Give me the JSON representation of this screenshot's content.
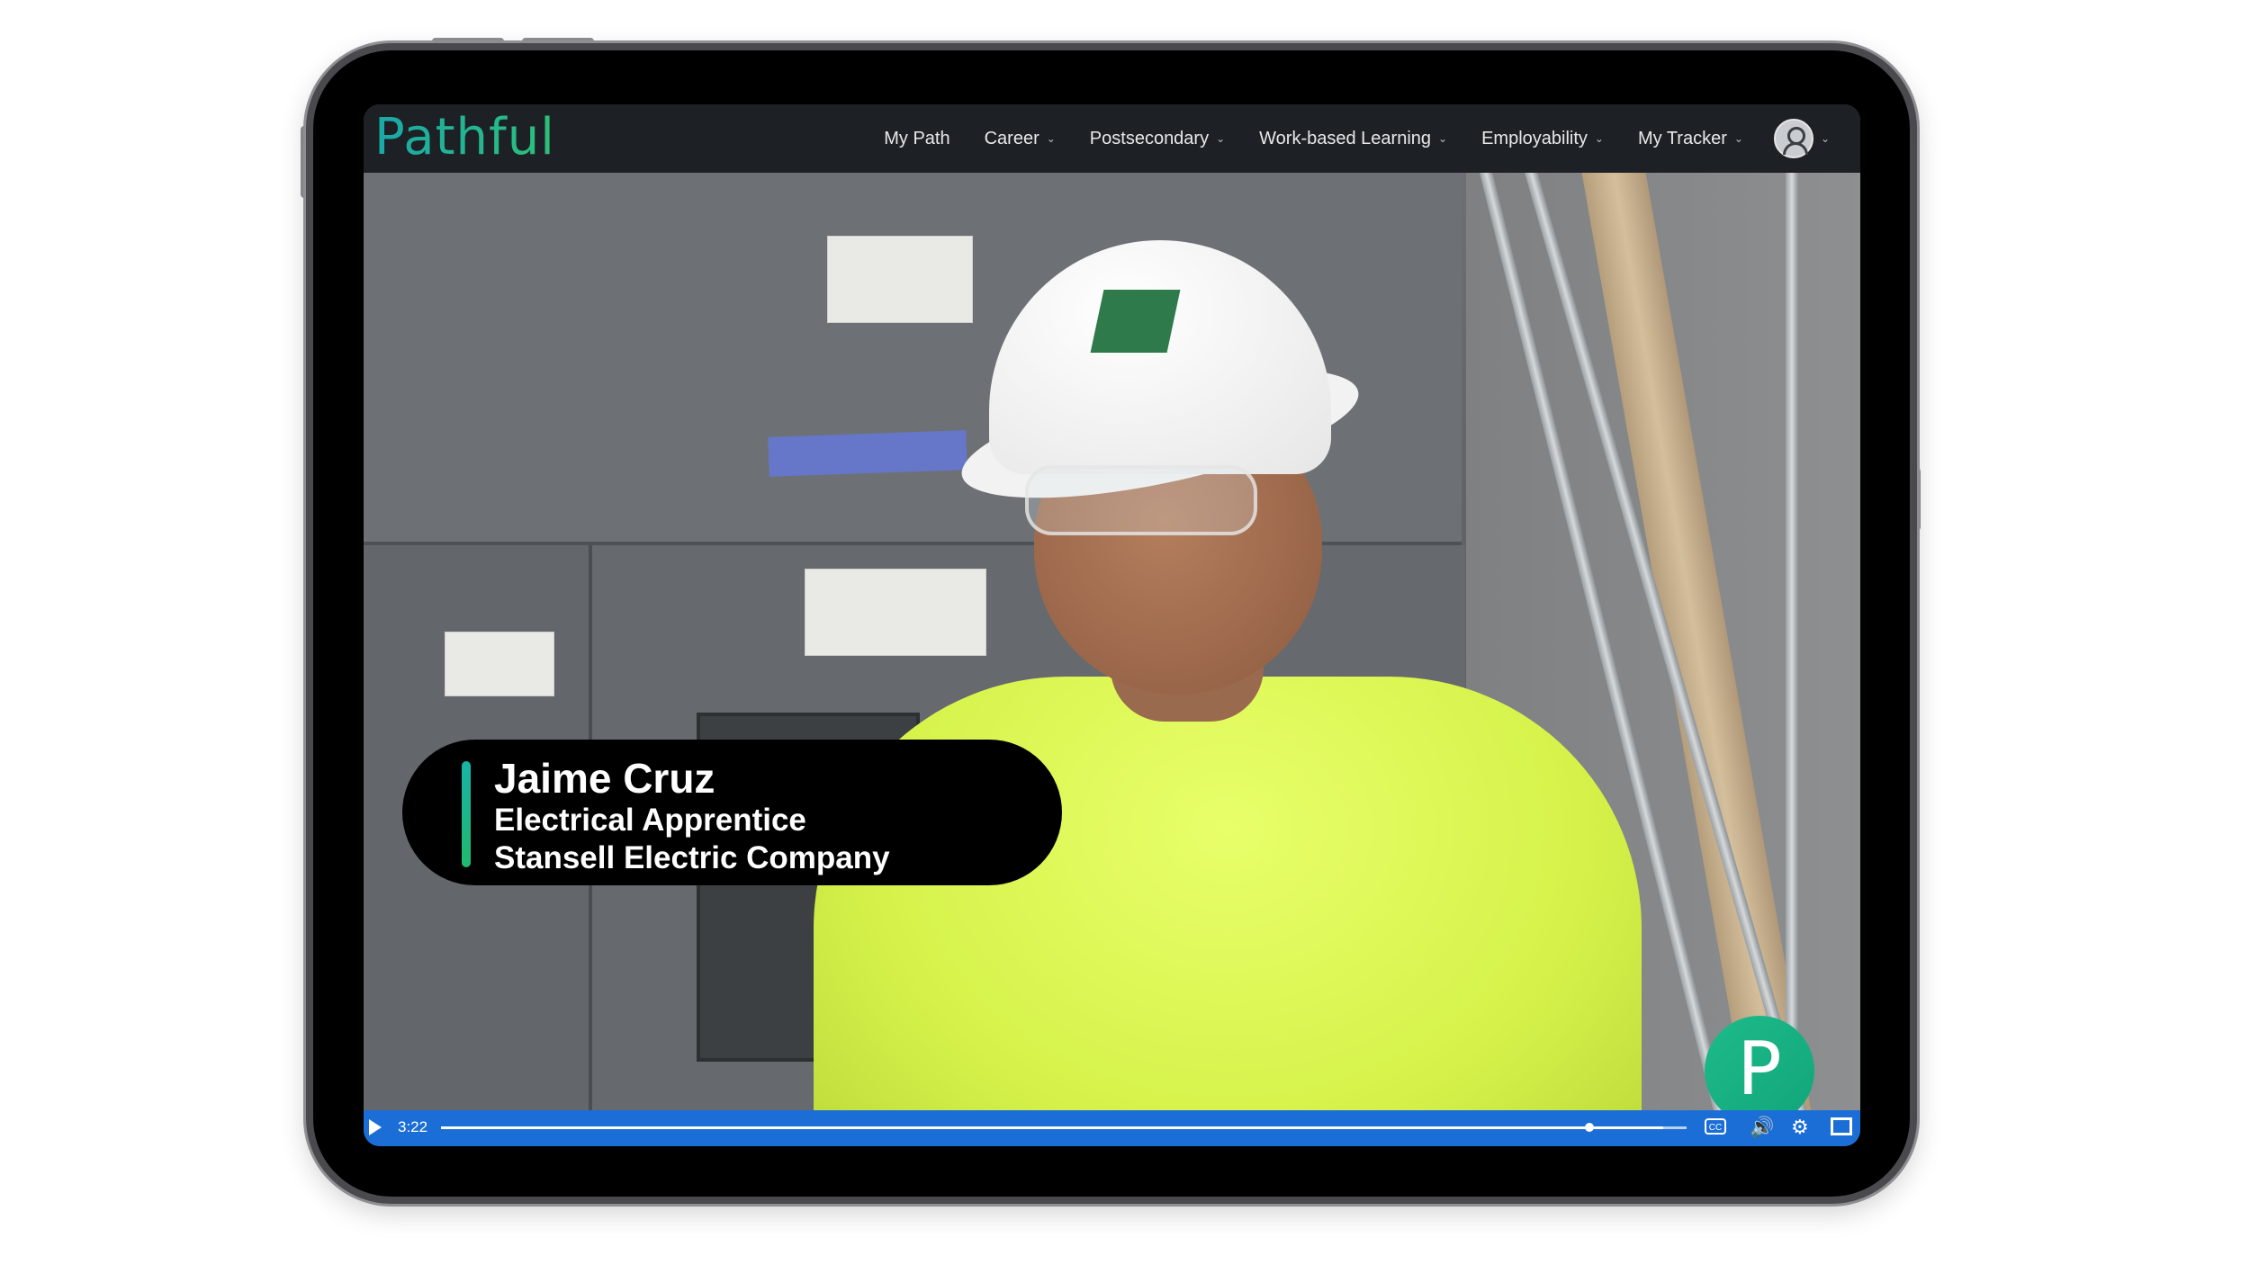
{
  "brand": {
    "logo_text": "Pathful",
    "bubble_letter": "P",
    "accent_color": "#1fb78e"
  },
  "nav": {
    "items": [
      {
        "label": "My Path",
        "has_dropdown": false
      },
      {
        "label": "Career",
        "has_dropdown": true
      },
      {
        "label": "Postsecondary",
        "has_dropdown": true
      },
      {
        "label": "Work-based Learning",
        "has_dropdown": true
      },
      {
        "label": "Employability",
        "has_dropdown": true
      },
      {
        "label": "My Tracker",
        "has_dropdown": true
      }
    ],
    "account_icon": "user-avatar-icon"
  },
  "video": {
    "lower_third": {
      "name": "Jaime Cruz",
      "role": "Electrical Apprentice",
      "company": "Stansell Electric Company"
    },
    "controls": {
      "time": "3:22",
      "progress": 0.981,
      "control_color": "#1b6ed6",
      "icons": [
        "play-icon",
        "closed-captions-icon",
        "volume-icon",
        "settings-icon",
        "fullscreen-icon"
      ],
      "cc_label": "CC"
    }
  }
}
